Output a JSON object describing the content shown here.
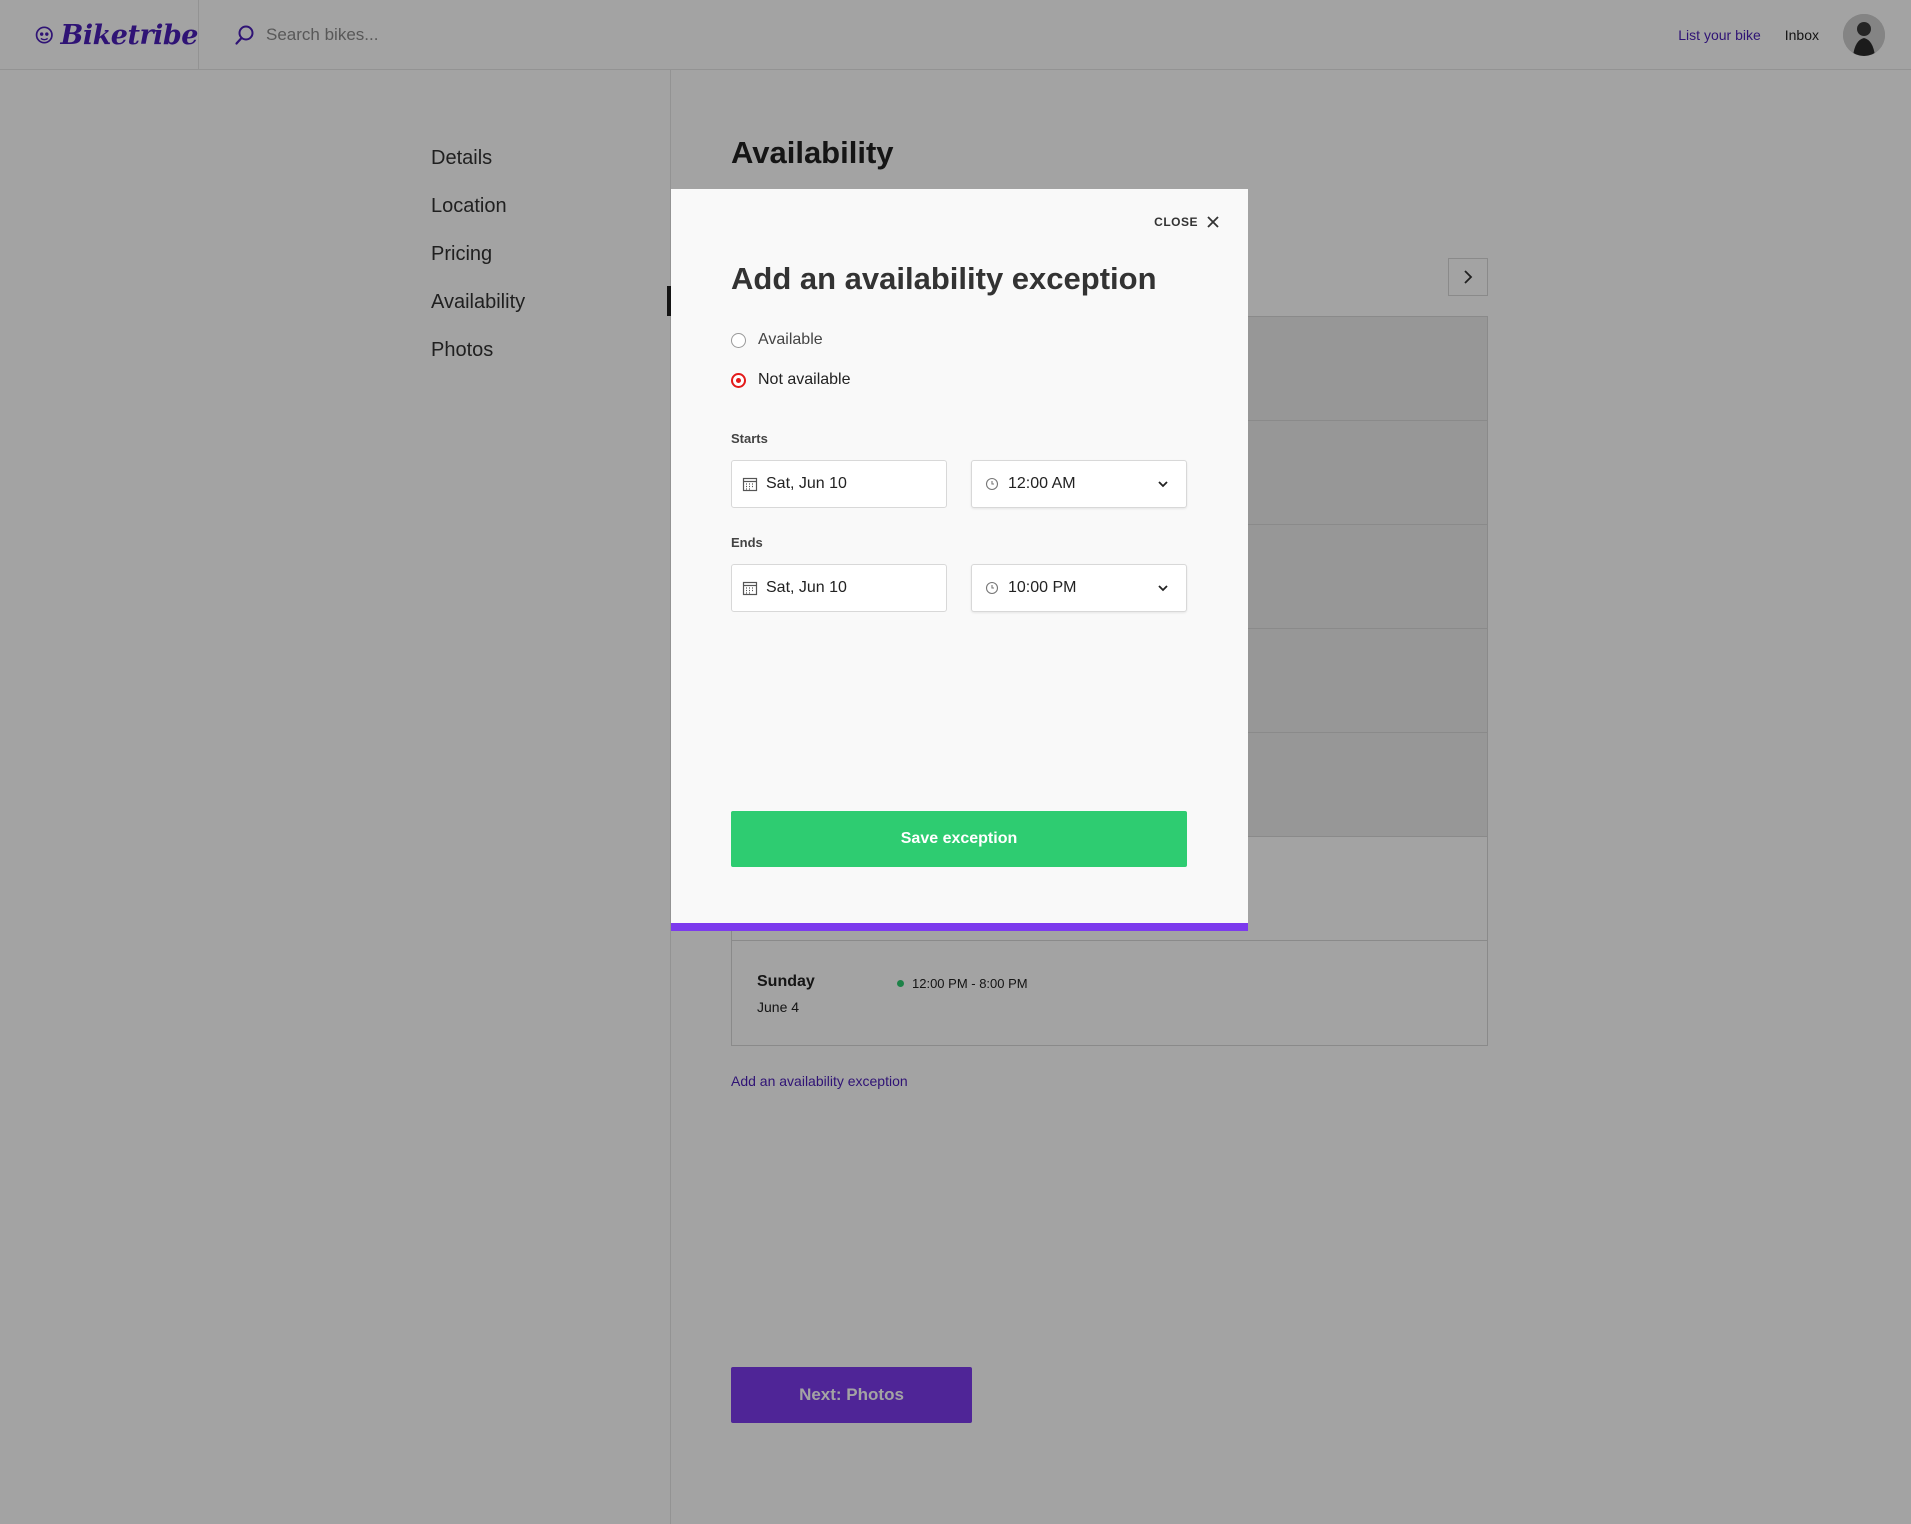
{
  "brand": {
    "name": "Biketribe",
    "accent": "#4a1fb8"
  },
  "search": {
    "placeholder": "Search bikes..."
  },
  "nav": {
    "list_bike": "List your bike",
    "inbox": "Inbox"
  },
  "sidebar": {
    "items": [
      {
        "label": "Details"
      },
      {
        "label": "Location"
      },
      {
        "label": "Pricing"
      },
      {
        "label": "Availability",
        "active": true
      },
      {
        "label": "Photos"
      }
    ]
  },
  "main": {
    "title": "Availability",
    "schedule": [
      {
        "day": "Sunday",
        "date": "June 4",
        "slot": "12:00 PM - 8:00 PM"
      }
    ],
    "add_exception_link": "Add an availability exception",
    "next_button": "Next: Photos"
  },
  "modal": {
    "close_label": "CLOSE",
    "title": "Add an availability exception",
    "options": [
      {
        "label": "Available",
        "checked": false
      },
      {
        "label": "Not available",
        "checked": true
      }
    ],
    "starts_label": "Starts",
    "starts_date": "Sat, Jun 10",
    "starts_time": "12:00 AM",
    "ends_label": "Ends",
    "ends_date": "Sat, Jun 10",
    "ends_time": "10:00 PM",
    "save_button": "Save exception",
    "colors": {
      "save": "#2ecc71",
      "bottom_bar": "#7c3aed",
      "radio_selected": "#e31b1b"
    }
  },
  "icons": [
    "bike-logo-icon",
    "search-icon",
    "chevron-right-icon",
    "close-icon",
    "calendar-icon",
    "clock-icon",
    "chevron-down-icon"
  ]
}
